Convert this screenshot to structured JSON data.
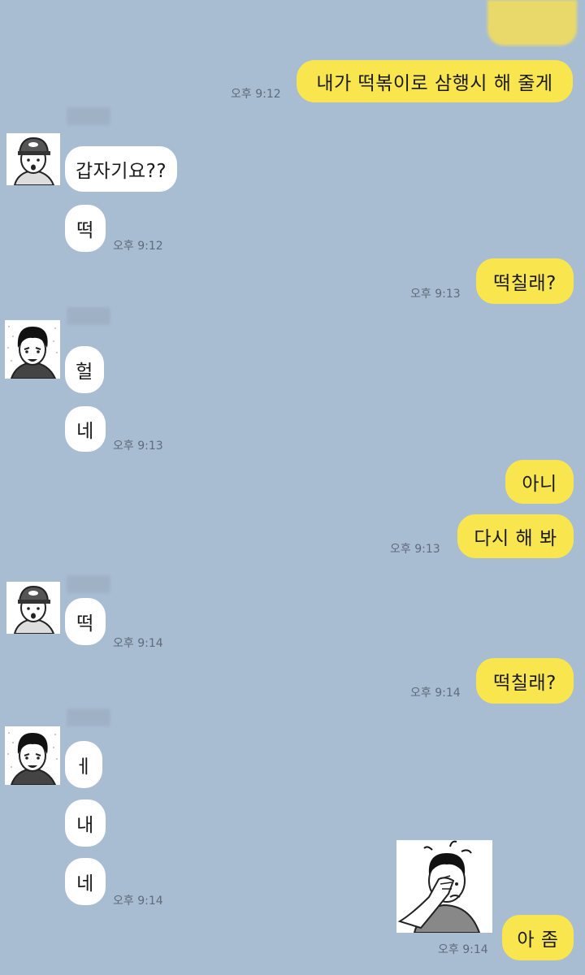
{
  "messages": [
    {
      "id": "m1",
      "side": "mine",
      "text": "내가 떡볶이로 삼행시 해 줄게",
      "time": "오후 9:12"
    },
    {
      "id": "m2",
      "side": "theirs",
      "sender": "user-a",
      "text": "갑자기요??"
    },
    {
      "id": "m3",
      "side": "theirs",
      "sender": "user-a",
      "text": "떡",
      "time": "오후 9:12"
    },
    {
      "id": "m4",
      "side": "mine",
      "text": "떡칠래?",
      "time": "오후 9:13"
    },
    {
      "id": "m5",
      "side": "theirs",
      "sender": "user-b",
      "text": "헐"
    },
    {
      "id": "m6",
      "side": "theirs",
      "sender": "user-b",
      "text": "네",
      "time": "오후 9:13"
    },
    {
      "id": "m7",
      "side": "mine",
      "text": "아니"
    },
    {
      "id": "m8",
      "side": "mine",
      "text": "다시 해 봐",
      "time": "오후 9:13"
    },
    {
      "id": "m9",
      "side": "theirs",
      "sender": "user-a",
      "text": "떡",
      "time": "오후 9:14"
    },
    {
      "id": "m10",
      "side": "mine",
      "text": "떡칠래?",
      "time": "오후 9:14"
    },
    {
      "id": "m11",
      "side": "theirs",
      "sender": "user-b",
      "text": "ㅔ"
    },
    {
      "id": "m12",
      "side": "theirs",
      "sender": "user-b",
      "text": "내"
    },
    {
      "id": "m13",
      "side": "theirs",
      "sender": "user-b",
      "text": "네",
      "time": "오후 9:14"
    },
    {
      "id": "m14",
      "side": "mine",
      "sticker": "facepalm-sticker"
    },
    {
      "id": "m15",
      "side": "mine",
      "text": "아 좀",
      "time": "오후 9:14"
    }
  ],
  "colors": {
    "background": "#a9bdd2",
    "my_bubble": "#f9e64e",
    "their_bubble": "#ffffff",
    "timestamp": "#5f6b7a"
  },
  "icons": {
    "user_a_avatar": "cap-boy-avatar-icon",
    "user_b_avatar": "dark-hair-boy-avatar-icon",
    "sticker": "facepalm-sticker-icon"
  }
}
